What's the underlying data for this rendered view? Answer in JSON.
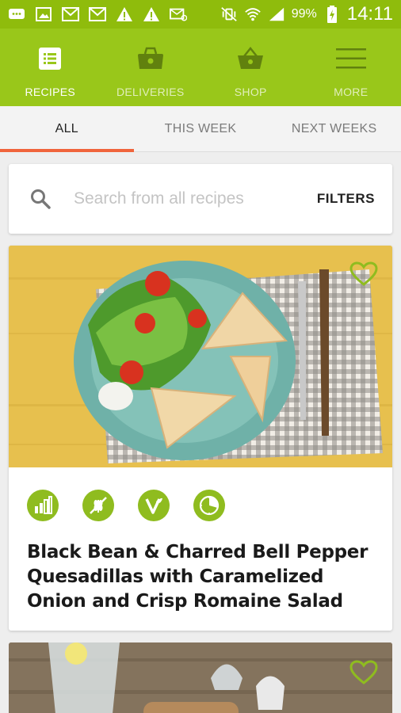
{
  "status_bar": {
    "battery": "99%",
    "time": "14:11"
  },
  "nav": {
    "items": [
      {
        "label": "RECIPES",
        "icon": "recipes-icon",
        "active": true
      },
      {
        "label": "DELIVERIES",
        "icon": "deliveries-icon",
        "active": false
      },
      {
        "label": "SHOP",
        "icon": "shop-basket-icon",
        "active": false
      },
      {
        "label": "MORE",
        "icon": "hamburger-menu-icon",
        "active": false
      }
    ]
  },
  "tabs": [
    {
      "label": "ALL",
      "active": true
    },
    {
      "label": "THIS WEEK",
      "active": false
    },
    {
      "label": "NEXT WEEKS",
      "active": false
    }
  ],
  "search": {
    "placeholder": "Search from all recipes",
    "filters_label": "FILTERS"
  },
  "recipes": [
    {
      "title": "Black Bean & Charred Bell Pepper Quesadillas with Caramelized Onion and Crisp Romaine Salad",
      "badges": [
        "difficulty-icon",
        "no-gluten-icon",
        "vegetarian-icon",
        "time-icon"
      ]
    }
  ],
  "colors": {
    "brand_green": "#99c71a",
    "status_green": "#8fbc0c",
    "tab_accent": "#f0643c",
    "badge_green": "#8fbc1f"
  }
}
